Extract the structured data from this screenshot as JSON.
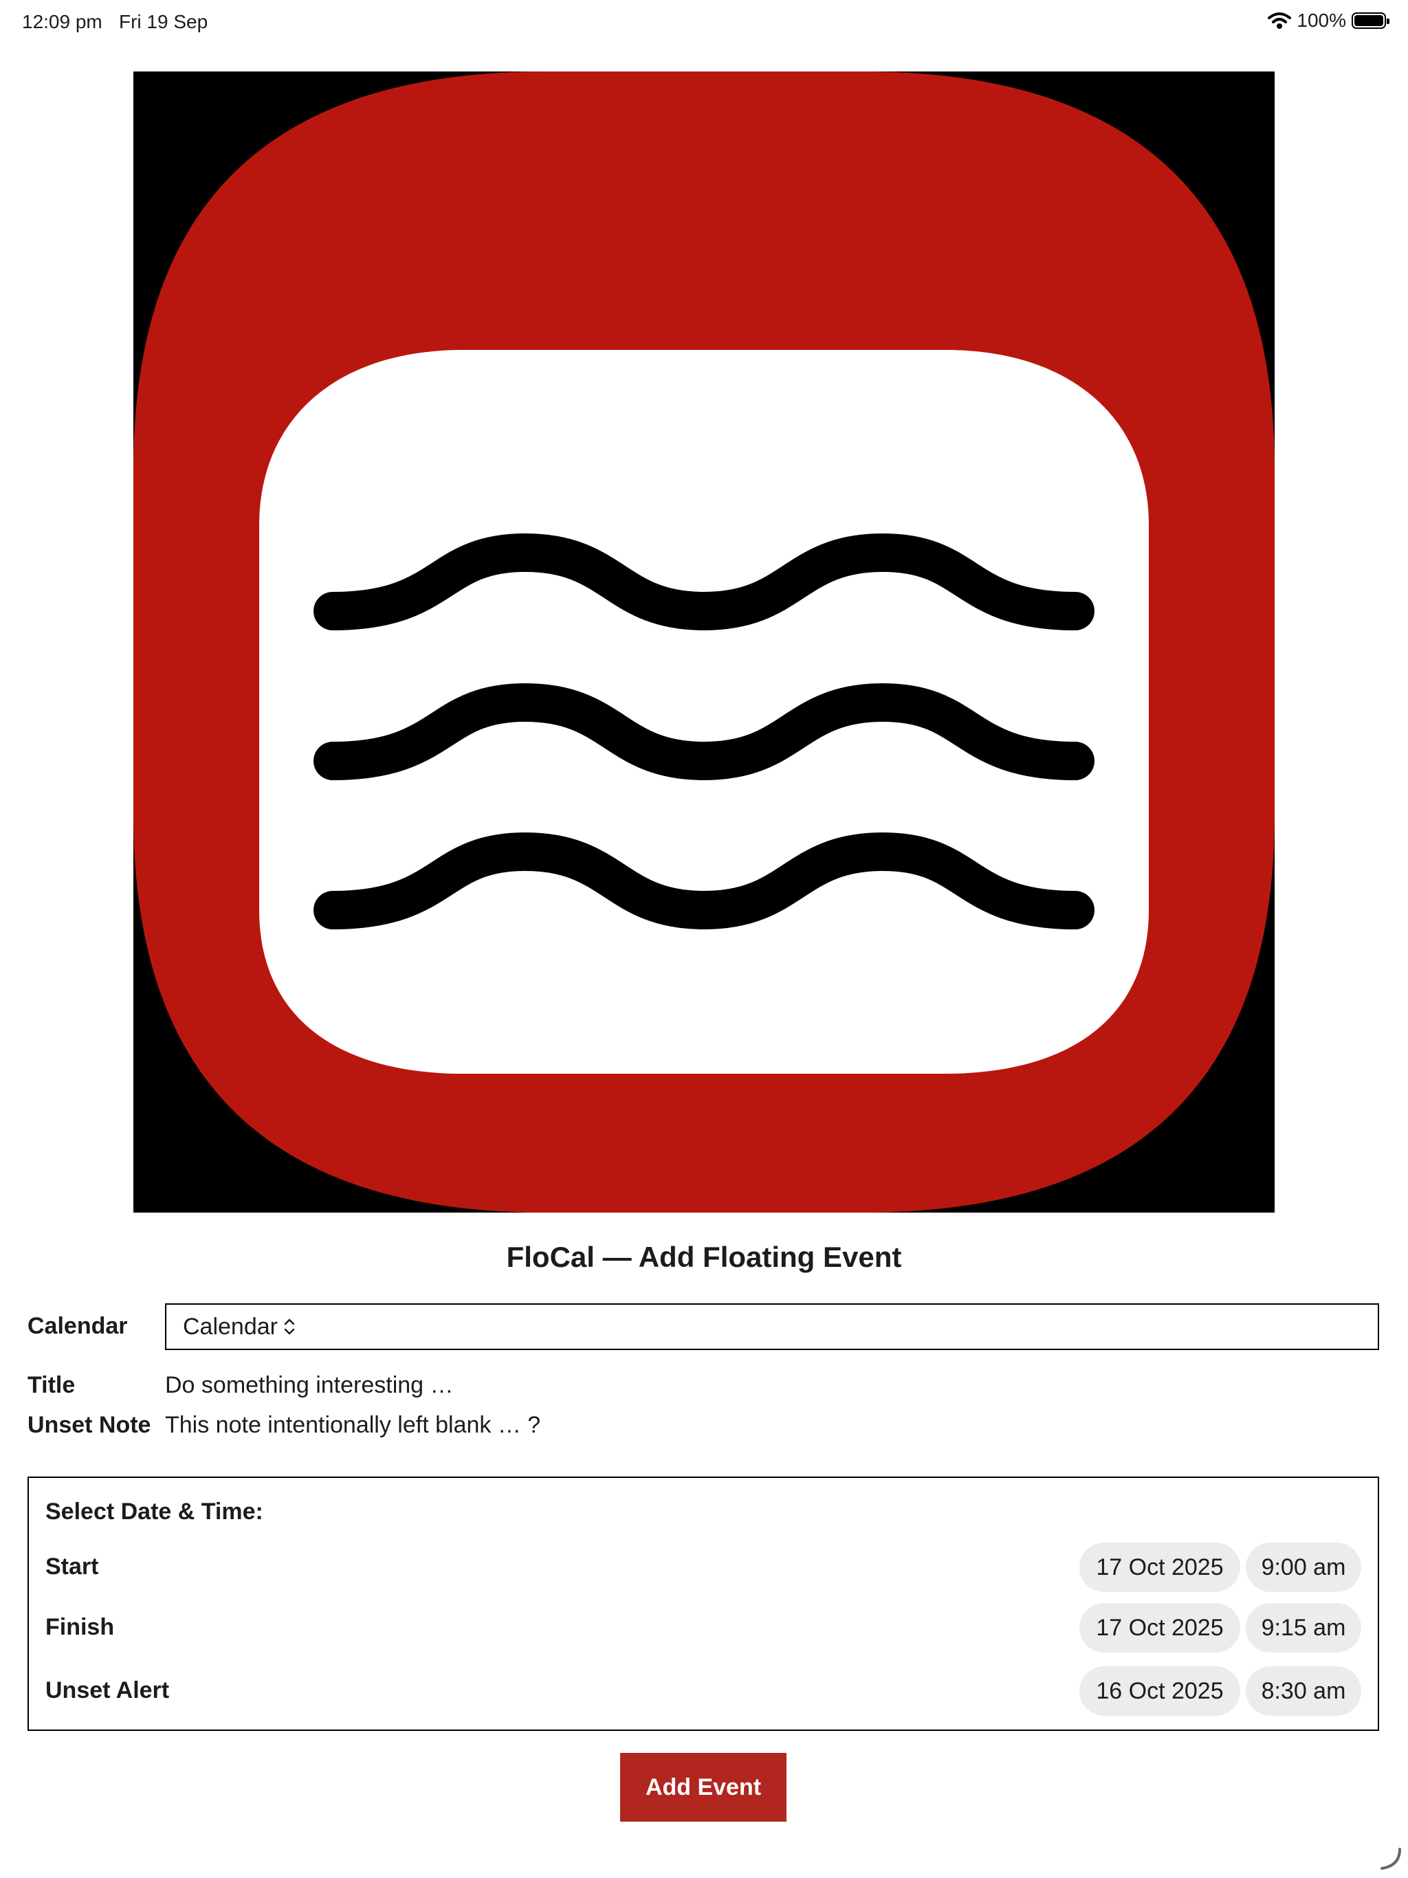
{
  "status_bar": {
    "time": "12:09 pm",
    "date": "Fri 19 Sep",
    "battery": "100%"
  },
  "logo": {
    "name": "FloCal app icon",
    "colors": {
      "frame": "#b8170f",
      "inner": "#ffffff",
      "waves": "#000000",
      "background": "#000000"
    }
  },
  "app_title": "FloCal — Add Floating Event",
  "form": {
    "calendar": {
      "label": "Calendar",
      "value": "Calendar"
    },
    "title": {
      "label": "Title",
      "value": "Do something interesting …"
    },
    "note": {
      "label": "Unset Note",
      "value": "This note intentionally left blank … ?"
    }
  },
  "datetime": {
    "heading": "Select Date & Time:",
    "start": {
      "label": "Start",
      "date": "17 Oct 2025",
      "time": "9:00 am"
    },
    "finish": {
      "label": "Finish",
      "date": "17 Oct 2025",
      "time": "9:15 am"
    },
    "alert": {
      "label": "Unset Alert",
      "date": "16 Oct 2025",
      "time": "8:30 am"
    }
  },
  "add_button": "Add Event",
  "accent_color": "#b1261e"
}
